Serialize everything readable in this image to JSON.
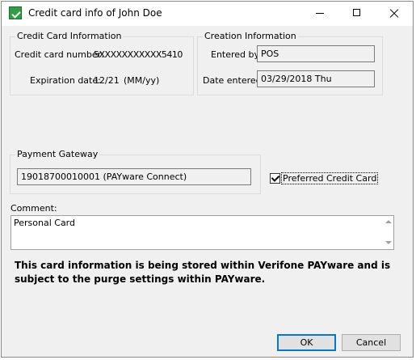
{
  "window": {
    "title": "Credit card info of John Doe"
  },
  "credit_card_info": {
    "legend": "Credit Card Information",
    "number_label": "Credit card number:",
    "number_value": "5XXXXXXXXXXX5410",
    "expiration_label": "Expiration date:",
    "expiration_value": "12/21",
    "expiration_format": "(MM/yy)"
  },
  "creation_info": {
    "legend": "Creation Information",
    "entered_by_label": "Entered by:",
    "entered_by_value": "POS",
    "date_entered_label": "Date entered:",
    "date_entered_value": "03/29/2018 Thu"
  },
  "payment_gateway": {
    "legend": "Payment Gateway",
    "value": "19018700010001 (PAYware Connect)"
  },
  "preferred": {
    "label": "Preferred Credit Card",
    "checked": true
  },
  "comment": {
    "label": "Comment:",
    "value": "Personal Card"
  },
  "notice": "This card information is being stored within Verifone PAYware and is subject to the purge settings within PAYware.",
  "buttons": {
    "ok": "OK",
    "cancel": "Cancel"
  },
  "colors": {
    "window_bg": "#f0f0f0",
    "default_button_border": "#0078d7"
  }
}
